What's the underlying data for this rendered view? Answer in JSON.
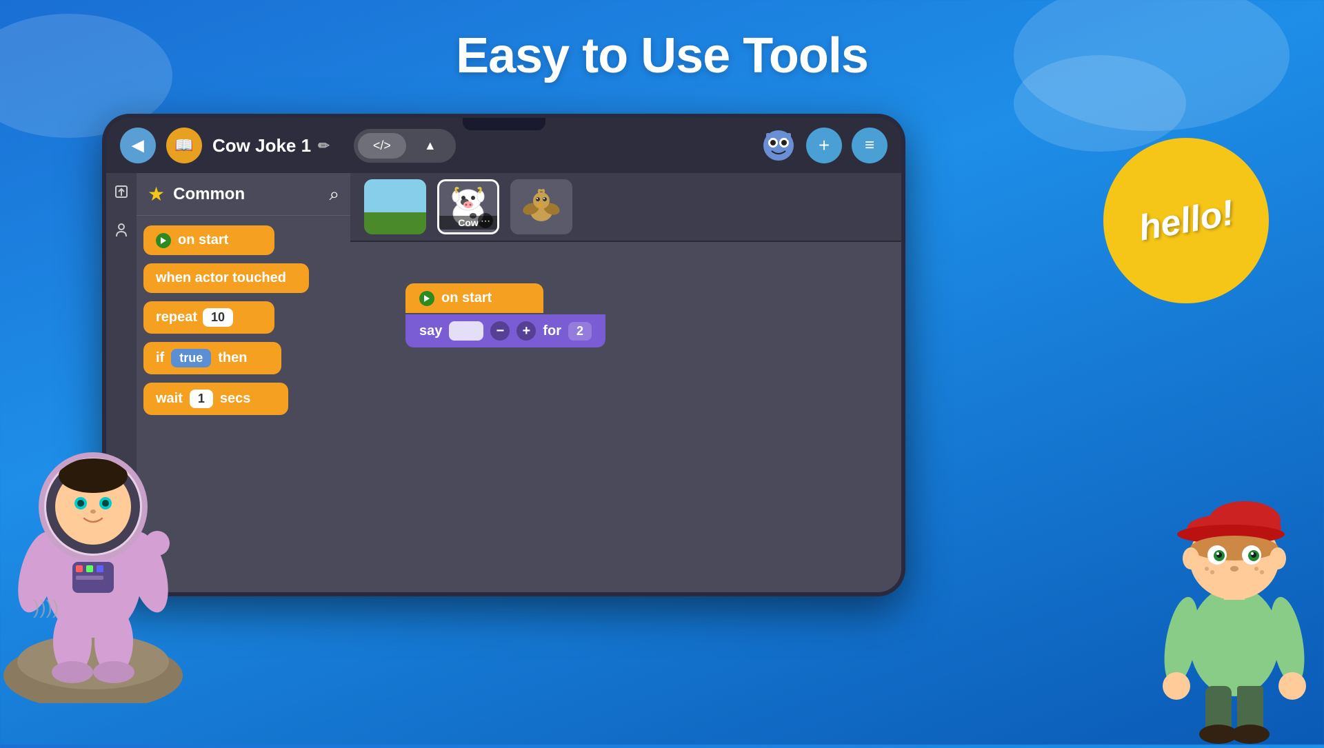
{
  "page": {
    "title": "Easy to Use Tools",
    "background_gradient_start": "#1a6fd4",
    "background_gradient_end": "#0a5ab5"
  },
  "header": {
    "back_label": "◀",
    "book_label": "📖",
    "project_title": "Cow Joke 1",
    "edit_icon": "✏️",
    "code_toggle_left": "</>",
    "code_toggle_right": "▲",
    "plus_label": "+",
    "menu_label": "≡"
  },
  "sidebar": {
    "title": "Common",
    "search_icon": "🔍",
    "blocks": [
      {
        "id": "on-start",
        "label": "on start",
        "type": "event"
      },
      {
        "id": "when-actor-touched",
        "label": "when actor touched",
        "type": "event"
      },
      {
        "id": "repeat",
        "label": "repeat",
        "value": "10",
        "type": "control"
      },
      {
        "id": "if-true",
        "label": "if",
        "value": "true",
        "suffix": "then",
        "type": "control"
      },
      {
        "id": "wait",
        "label": "wait",
        "value": "1",
        "suffix": "secs",
        "type": "control"
      }
    ]
  },
  "sprites": [
    {
      "id": "scene",
      "label": "scene",
      "active": false
    },
    {
      "id": "cow",
      "label": "Cow",
      "active": true
    },
    {
      "id": "bird",
      "label": "",
      "active": false
    }
  ],
  "canvas": {
    "block_group": {
      "event": "on start",
      "say_label": "say",
      "for_label": "for",
      "for_value": "2"
    }
  },
  "hello_bubble": {
    "text": "hello!"
  },
  "icons": {
    "back": "◀",
    "play": "▶",
    "search": "⌕",
    "plus": "+",
    "menu": "≡",
    "edit": "✏",
    "star": "★",
    "share": "⇧",
    "figure": "🚶",
    "code": "</>",
    "scene_view": "▲"
  }
}
